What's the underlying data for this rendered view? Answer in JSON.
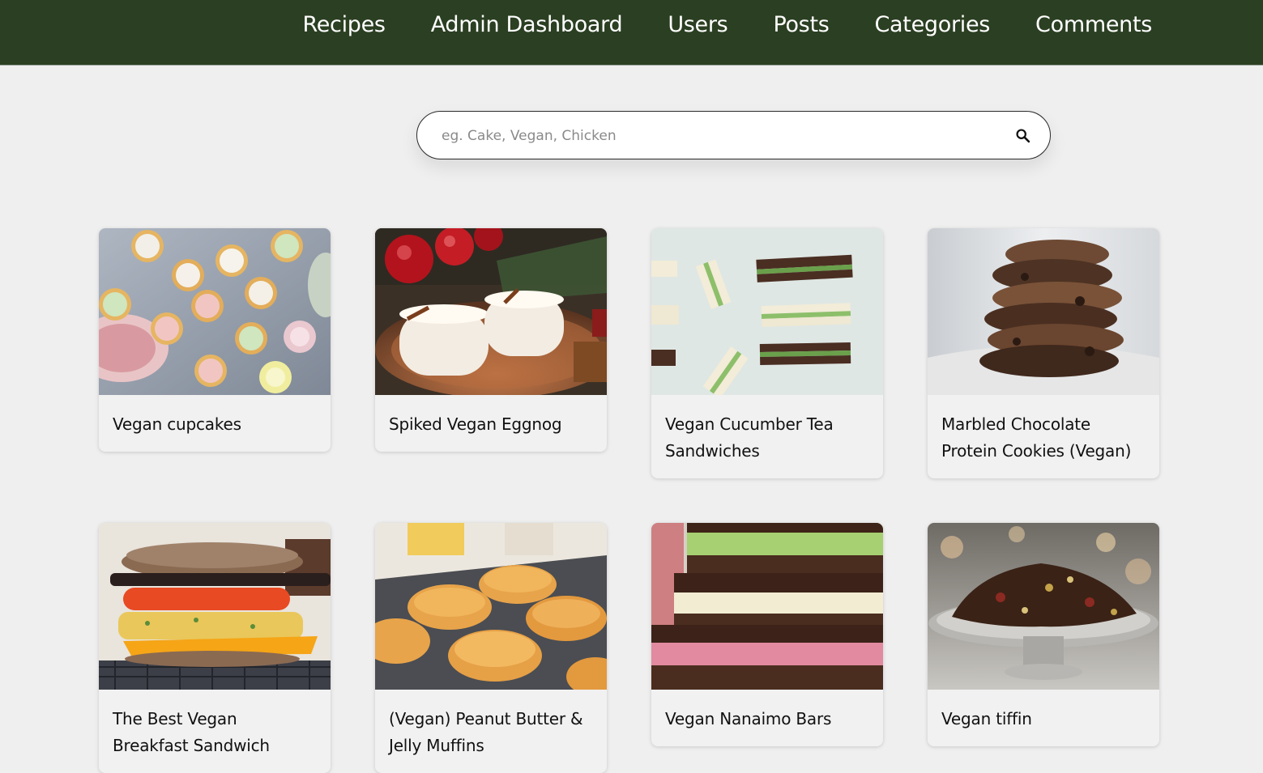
{
  "nav": {
    "items": [
      {
        "label": "Recipes"
      },
      {
        "label": "Admin Dashboard"
      },
      {
        "label": "Users"
      },
      {
        "label": "Posts"
      },
      {
        "label": "Categories"
      },
      {
        "label": "Comments"
      }
    ]
  },
  "search": {
    "placeholder": "eg. Cake, Vegan, Chicken",
    "value": "",
    "icon": "search-icon"
  },
  "recipes": [
    {
      "title": "Vegan cupcakes",
      "image": "cupcakes-photo"
    },
    {
      "title": "Spiked Vegan Eggnog",
      "image": "eggnog-photo"
    },
    {
      "title": "Vegan Cucumber Tea Sandwiches",
      "image": "tea-sandwiches-photo"
    },
    {
      "title": "Marbled Chocolate Protein Cookies (Vegan)",
      "image": "chocolate-cookies-photo"
    },
    {
      "title": "The Best Vegan Breakfast Sandwich",
      "image": "breakfast-sandwich-photo"
    },
    {
      "title": "(Vegan) Peanut Butter & Jelly Muffins",
      "image": "muffins-photo"
    },
    {
      "title": "Vegan Nanaimo Bars",
      "image": "nanaimo-bars-photo"
    },
    {
      "title": "Vegan tiffin",
      "image": "tiffin-photo"
    }
  ],
  "colors": {
    "header_bg": "#2b3f22",
    "page_bg": "#efefef",
    "card_bg": "#f1f1f1"
  }
}
